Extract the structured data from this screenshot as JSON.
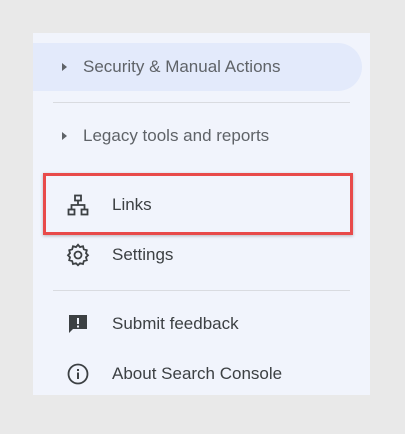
{
  "nav": {
    "security_label": "Security & Manual Actions",
    "legacy_label": "Legacy tools and reports",
    "links_label": "Links",
    "settings_label": "Settings",
    "feedback_label": "Submit feedback",
    "about_label": "About Search Console"
  },
  "icons": {
    "caret": "caret-right-icon",
    "links": "sitemap-icon",
    "settings": "gear-icon",
    "feedback": "feedback-icon",
    "about": "info-icon"
  },
  "colors": {
    "highlight_border": "#e84a4a",
    "selected_bg": "#e3eafb",
    "panel_bg": "#f1f4fc",
    "page_bg": "#e9e9e9"
  }
}
